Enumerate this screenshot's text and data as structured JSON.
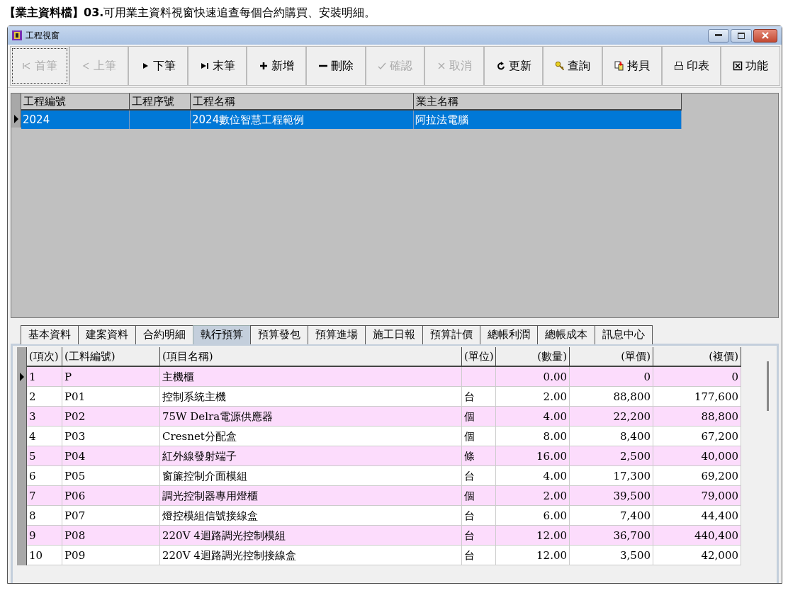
{
  "caption": "**【業主資料檔】03.**可用業主資料視窗快速追查每個合約購買、安裝明細。",
  "window": {
    "title": "工程視窗"
  },
  "toolbar": [
    {
      "label": "首筆",
      "kind": "first",
      "disabled": true,
      "focused": true
    },
    {
      "label": "上筆",
      "kind": "prev",
      "disabled": true,
      "focused": false
    },
    {
      "label": "下筆",
      "kind": "next",
      "disabled": false,
      "focused": false
    },
    {
      "label": "末筆",
      "kind": "last",
      "disabled": false,
      "focused": false
    },
    {
      "label": "新增",
      "kind": "plus",
      "disabled": false,
      "focused": false
    },
    {
      "label": "刪除",
      "kind": "minus",
      "disabled": false,
      "focused": false
    },
    {
      "label": "確認",
      "kind": "check",
      "disabled": true,
      "focused": false
    },
    {
      "label": "取消",
      "kind": "cross",
      "disabled": true,
      "focused": false
    },
    {
      "label": "更新",
      "kind": "refresh",
      "disabled": false,
      "focused": false
    },
    {
      "label": "查詢",
      "kind": "key",
      "disabled": false,
      "focused": false
    },
    {
      "label": "拷貝",
      "kind": "copy",
      "disabled": false,
      "focused": false
    },
    {
      "label": "印表",
      "kind": "printer",
      "disabled": false,
      "focused": false
    },
    {
      "label": "功能",
      "kind": "box",
      "disabled": false,
      "focused": false
    }
  ],
  "project_table": {
    "columns": [
      "工程編號",
      "工程序號",
      "工程名稱",
      "業主名稱"
    ],
    "rows": [
      {
        "cells": [
          "2024",
          "",
          "2024數位智慧工程範例",
          "阿拉法電腦"
        ],
        "selected": true
      }
    ]
  },
  "tabs": [
    {
      "label": "基本資料",
      "selected": false
    },
    {
      "label": "建案資料",
      "selected": false
    },
    {
      "label": "合約明細",
      "selected": false
    },
    {
      "label": "執行預算",
      "selected": true
    },
    {
      "label": "預算發包",
      "selected": false
    },
    {
      "label": "預算進場",
      "selected": false
    },
    {
      "label": "施工日報",
      "selected": false
    },
    {
      "label": "預算計價",
      "selected": false
    },
    {
      "label": "總帳利潤",
      "selected": false
    },
    {
      "label": "總帳成本",
      "selected": false
    },
    {
      "label": "訊息中心",
      "selected": false
    }
  ],
  "budget_table": {
    "columns": [
      "(項次)",
      "(工料編號)",
      "(項目名稱)",
      "(單位)",
      "(數量)",
      "(單價)",
      "(複價)"
    ],
    "rows": [
      {
        "cells": [
          "1",
          "P",
          "主機櫃",
          "",
          "0.00",
          "0",
          "0"
        ],
        "selected": true
      },
      {
        "cells": [
          "2",
          "P01",
          "控制系統主機",
          "台",
          "2.00",
          "88,800",
          "177,600"
        ],
        "selected": false
      },
      {
        "cells": [
          "3",
          "P02",
          "75W Delra電源供應器",
          "個",
          "4.00",
          "22,200",
          "88,800"
        ],
        "selected": false
      },
      {
        "cells": [
          "4",
          "P03",
          "Cresnet分配盒",
          "個",
          "8.00",
          "8,400",
          "67,200"
        ],
        "selected": false
      },
      {
        "cells": [
          "5",
          "P04",
          "紅外線發射端子",
          "條",
          "16.00",
          "2,500",
          "40,000"
        ],
        "selected": false
      },
      {
        "cells": [
          "6",
          "P05",
          "窗簾控制介面模組",
          "台",
          "4.00",
          "17,300",
          "69,200"
        ],
        "selected": false
      },
      {
        "cells": [
          "7",
          "P06",
          "調光控制器專用燈櫃",
          "個",
          "2.00",
          "39,500",
          "79,000"
        ],
        "selected": false
      },
      {
        "cells": [
          "8",
          "P07",
          "燈控模組信號接線盒",
          "台",
          "6.00",
          "7,400",
          "44,400"
        ],
        "selected": false
      },
      {
        "cells": [
          "9",
          "P08",
          "220V 4迴路調光控制模組",
          "台",
          "12.00",
          "36,700",
          "440,400"
        ],
        "selected": false
      },
      {
        "cells": [
          "10",
          "P09",
          "220V 4迴路調光控制接線盒",
          "台",
          "12.00",
          "3,500",
          "42,000"
        ],
        "selected": false
      }
    ]
  }
}
